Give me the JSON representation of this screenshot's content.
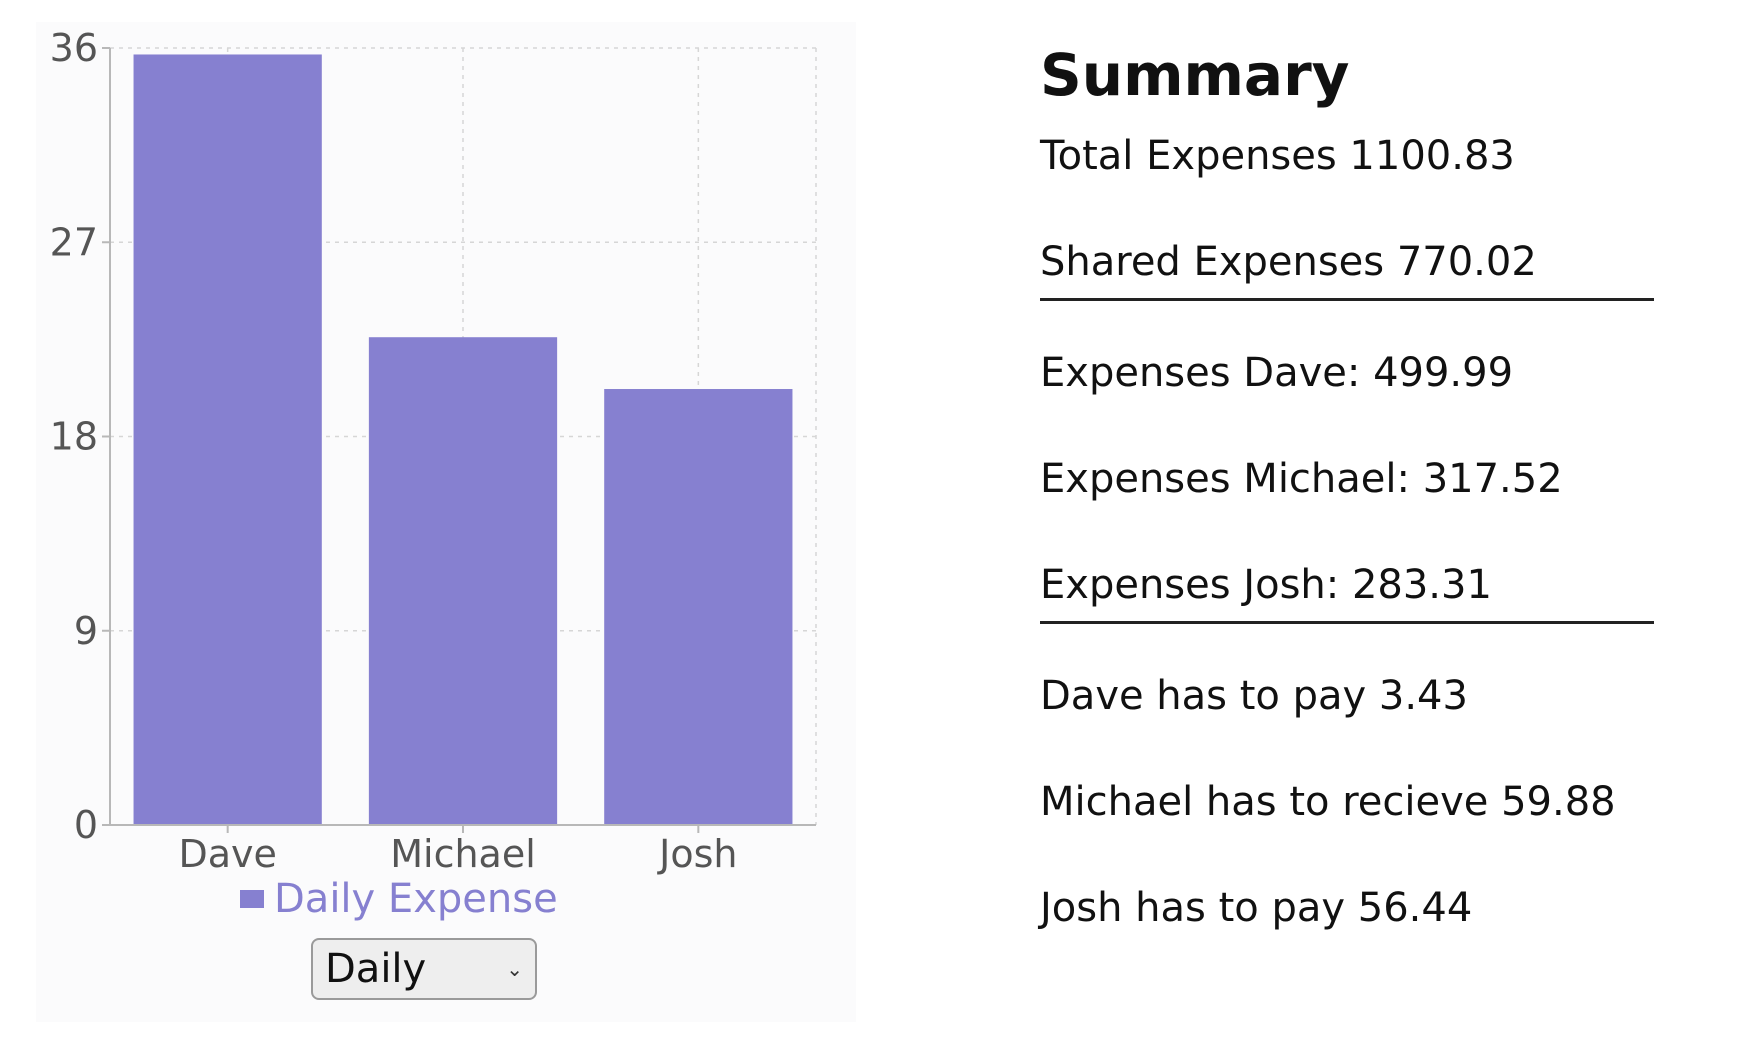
{
  "chart_data": {
    "type": "bar",
    "categories": [
      "Dave",
      "Michael",
      "Josh"
    ],
    "series": [
      {
        "name": "Daily Expense",
        "values": [
          35.7,
          22.6,
          20.2
        ]
      }
    ],
    "yticks": [
      0,
      9,
      18,
      27,
      36
    ],
    "ylim": [
      0,
      36
    ],
    "grid": true,
    "legend_position": "bottom",
    "colors": {
      "bar": "#8680d0",
      "axis": "#b8b8b8",
      "grid": "#d6d6d6",
      "tick_text": "#555555"
    }
  },
  "period_select": {
    "value": "Daily"
  },
  "summary": {
    "title": "Summary",
    "total": "Total Expenses 1100.83",
    "shared": "Shared Expenses 770.02",
    "expenses": [
      "Expenses Dave: 499.99",
      "Expenses Michael: 317.52",
      "Expenses Josh: 283.31"
    ],
    "settlements": [
      "Dave has to pay 3.43",
      "Michael has to recieve 59.88",
      "Josh has to pay 56.44"
    ]
  }
}
